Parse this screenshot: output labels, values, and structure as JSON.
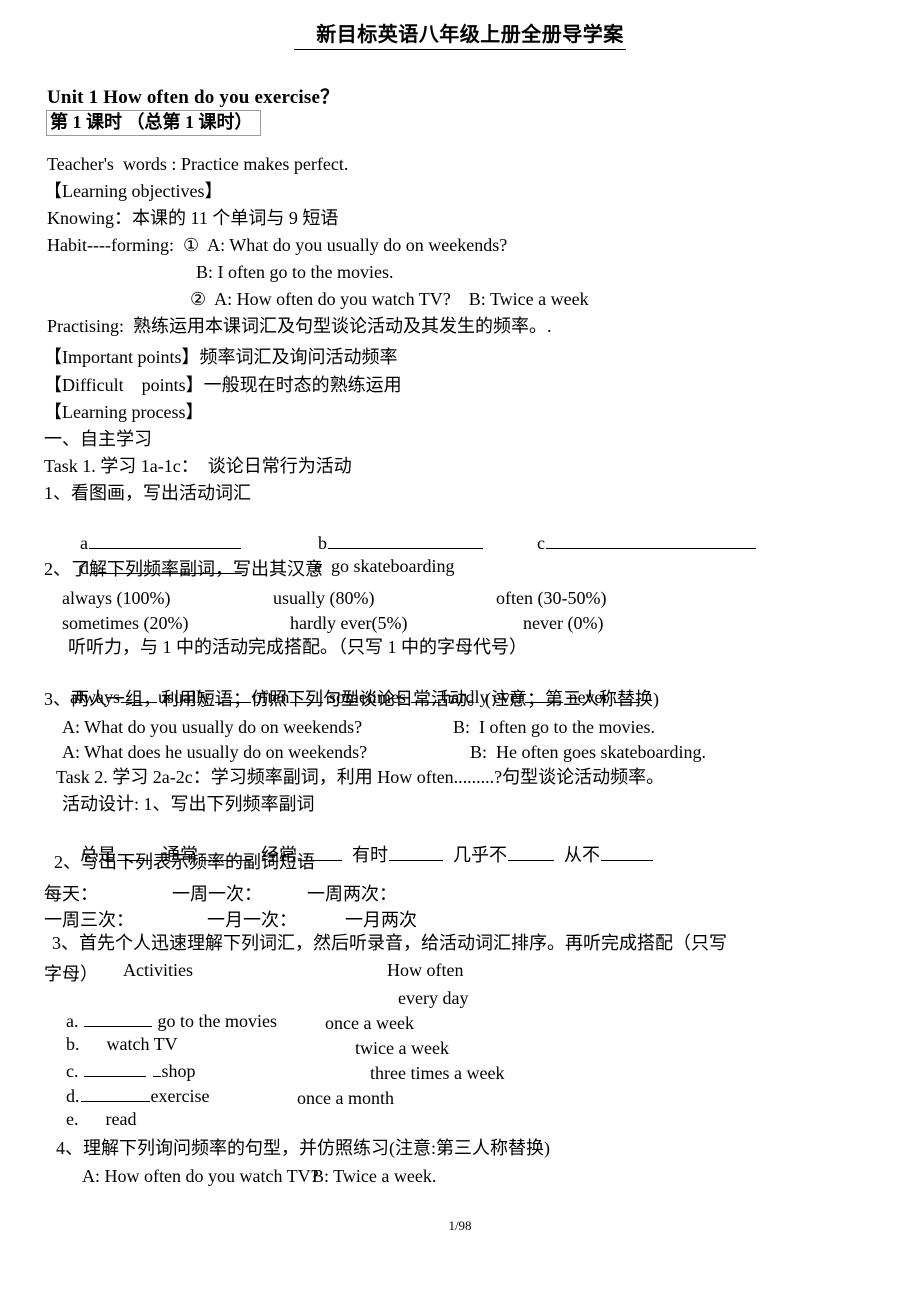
{
  "document": {
    "title": "新目标英语八年级上册全册导学案",
    "page_number": "1/98"
  },
  "unit": {
    "heading": "Unit 1   How often do you exercise？",
    "period_box": "第 1 课时 （总第 1 课时）"
  },
  "intro": {
    "teachers_words": "Teacher's  words : Practice makes perfect.",
    "learning_objectives_label": "【Learning objectives】",
    "knowing": "Knowing：本课的 11 个单词与 9 短语",
    "habit_forming": "Habit----forming:  ①  A: What do you usually do on weekends?",
    "habit_forming_b": "B: I often go to the movies.",
    "habit_forming_2": "②  A: How often do you watch TV?    B: Twice a week",
    "practising": "Practising:  熟练运用本课词汇及句型谈论活动及其发生的频率。.",
    "important_points": "【Important points】频率词汇及询问活动频率",
    "difficult_points": "【Difficult    points】一般现在时态的熟练运用",
    "learning_process_label": "【Learning process】"
  },
  "section_one": {
    "heading": "一、自主学习",
    "task1": "Task 1. 学习 1a-1c：  谈论日常行为活动",
    "sub1": "1、看图画，写出活动词汇",
    "picture_items": {
      "a": "a",
      "b": "b",
      "c": "c",
      "d": "d",
      "e_label": "e",
      "e_value": "go skateboarding"
    },
    "sub2": "2、了解下列频率副词，写出其汉意",
    "adverbs_row1": [
      "always (100%)",
      "usually (80%)",
      "often (30-50%)"
    ],
    "adverbs_row2": [
      "sometimes (20%)",
      "hardly ever(5%)",
      "never (0%)"
    ],
    "listening_note": "听听力，与 1 中的活动完成搭配。（只写 1 中的字母代号）",
    "match_line": [
      "always",
      "usually",
      "often",
      "sometimes",
      "hardly ever",
      "never"
    ],
    "sub3": "3、两人一组，利用短语；仿照下列句型谈论日常活动。(注意；第三人称替换)",
    "dialog1_a": "A: What do you usually do on weekends?",
    "dialog1_b": "B:  I often go to the movies.",
    "dialog2_a": "A: What does he usually do on weekends?",
    "dialog2_b": "B:  He often goes skateboarding."
  },
  "task2": {
    "heading": "Task 2. 学习 2a-2c：学习频率副词，利用 How often.........?句型谈论活动频率。",
    "activity_design": "活动设计: 1、写出下列频率副词",
    "adverb_blanks": [
      "总是",
      "通常",
      "经常",
      "有时",
      "几乎不",
      "从不"
    ],
    "sub2": "2、写出下列表示频率的副词短语",
    "phrases_row1": [
      "每天：",
      "一周一次：",
      "一周两次："
    ],
    "phrases_row2": [
      "一周三次：",
      "一月一次：",
      "一月两次"
    ],
    "sub3_line1": "3、首先个人迅速理解下列词汇，然后听录音，给活动词汇排序。再听完成搭配（只写",
    "sub3_line2_prefix": "字母）",
    "col_header_activities": "Activities",
    "col_header_how_often": "How often",
    "match_rows": [
      {
        "letter": "a.",
        "blank": true,
        "activity": "go to the movies",
        "how_often": "every day"
      },
      {
        "letter": "b.",
        "blank": false,
        "activity": "watch TV",
        "how_often": "once a week"
      },
      {
        "letter": "c.",
        "blank": true,
        "activity": "shop",
        "how_often": "twice a week"
      },
      {
        "letter": "d.",
        "blank": true,
        "activity": "exercise",
        "how_often": "three times a week"
      },
      {
        "letter": "e.",
        "blank": false,
        "activity": "read",
        "how_often": "once a month"
      }
    ],
    "sub4": "4、理解下列询问频率的句型，并仿照练习(注意:第三人称替换)",
    "dialog_a": "A: How often do you watch TV?",
    "dialog_b": "B: Twice a week."
  }
}
